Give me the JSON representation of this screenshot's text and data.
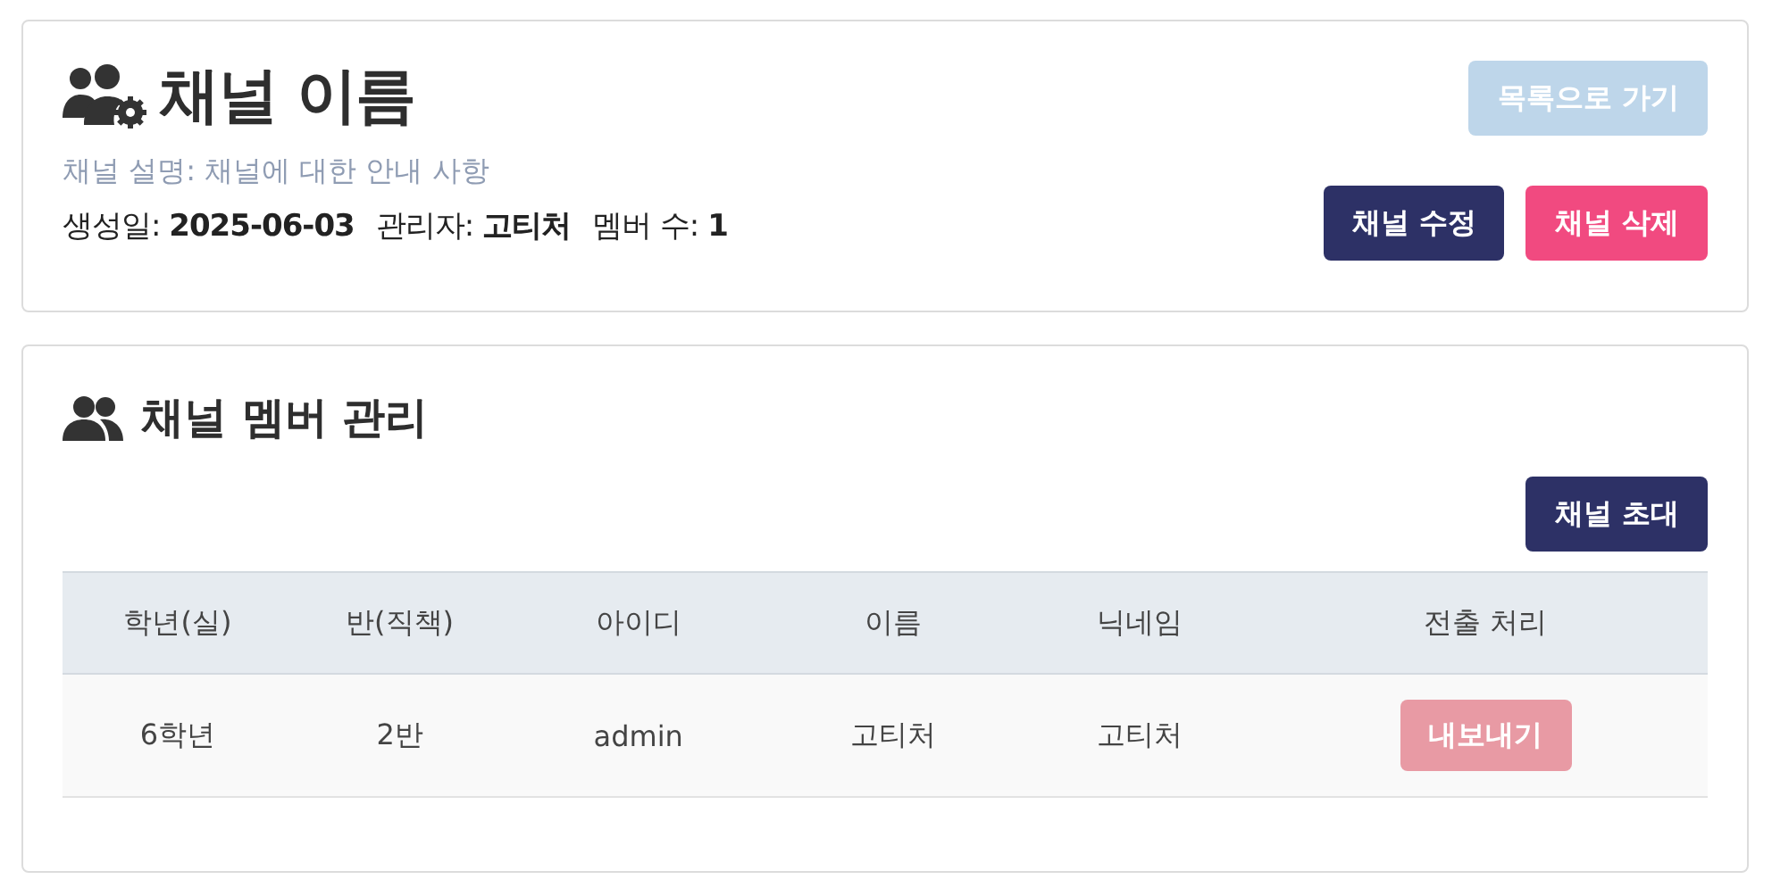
{
  "channel": {
    "title": "채널 이름",
    "description": "채널 설명: 채널에 대한 안내 사항",
    "meta": [
      {
        "label": "생성일:",
        "value": "2025-06-03"
      },
      {
        "label": "관리자:",
        "value": "고티처"
      },
      {
        "label": "멤버 수:",
        "value": "1"
      }
    ],
    "back_button": {
      "label": "목록으로 가기",
      "disabled": true
    },
    "actions": [
      {
        "label": "채널 수정",
        "kind": "edit"
      },
      {
        "label": "채널 삭제",
        "kind": "delete"
      }
    ]
  },
  "members": {
    "title": "채널 멤버 관리",
    "invite_button": "채널 초대",
    "table": {
      "columns": [
        "학년(실)",
        "반(직책)",
        "아이디",
        "이름",
        "닉네임",
        "전출 처리"
      ],
      "rows": [
        {
          "cells": [
            "6학년",
            "2반",
            "admin",
            "고티처",
            "고티처"
          ],
          "action": {
            "label": "내보내기",
            "disabled": true
          }
        }
      ]
    }
  }
}
